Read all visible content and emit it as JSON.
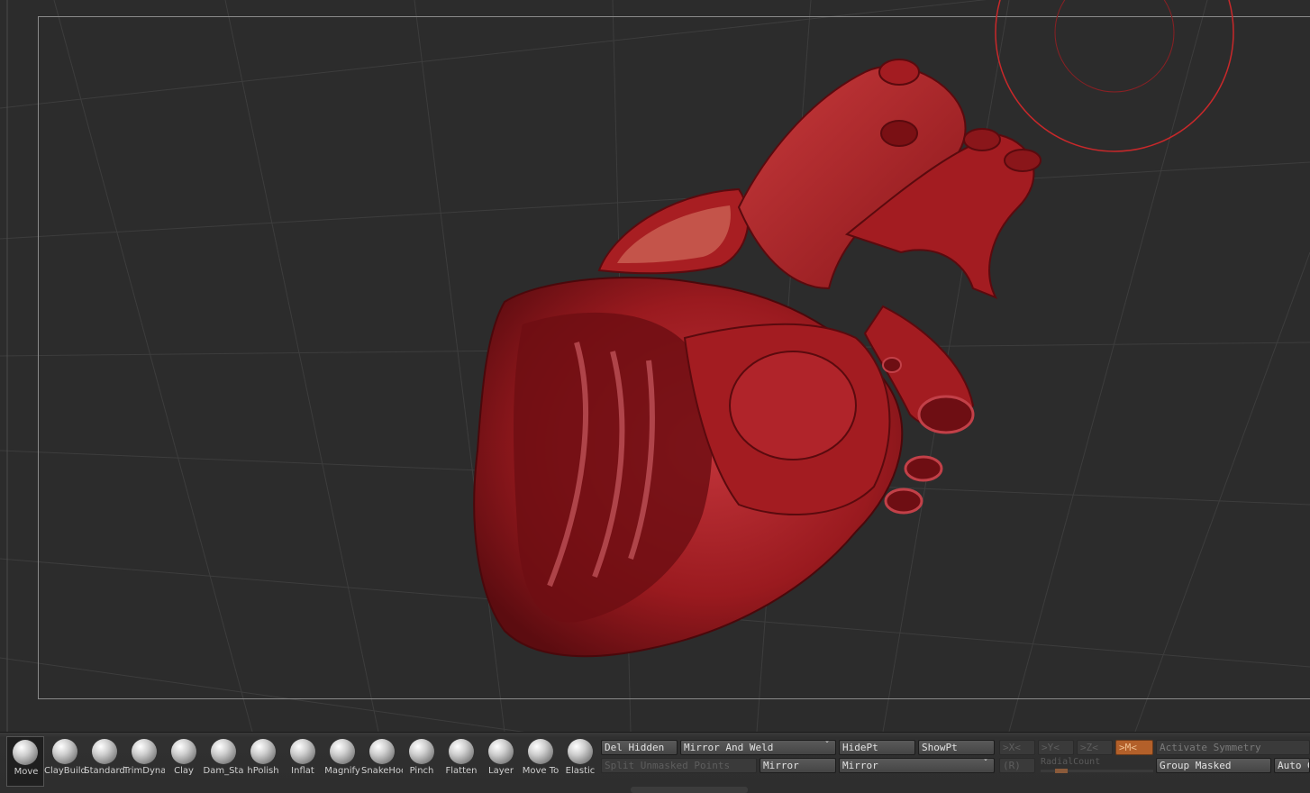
{
  "brushes": [
    {
      "label": "Move",
      "active": true
    },
    {
      "label": "ClayBuildup"
    },
    {
      "label": "Standard"
    },
    {
      "label": "TrimDyna"
    },
    {
      "label": "Clay"
    },
    {
      "label": "Dam_Sta"
    },
    {
      "label": "hPolish"
    },
    {
      "label": "Inflat"
    },
    {
      "label": "Magnify"
    },
    {
      "label": "SnakeHoo"
    },
    {
      "label": "Pinch"
    },
    {
      "label": "Flatten"
    },
    {
      "label": "Layer"
    },
    {
      "label": "Move To"
    },
    {
      "label": "Elastic"
    }
  ],
  "toolbar": {
    "del_hidden": "Del Hidden",
    "mirror_and_weld": "Mirror And Weld",
    "hide_pt": "HidePt",
    "show_pt": "ShowPt",
    "split_unmasked": "Split Unmasked Points",
    "mirror1": "Mirror",
    "mirror2": "Mirror",
    "sym_x": ">X<",
    "sym_y": ">Y<",
    "sym_z": ">Z<",
    "sym_m": ">M<",
    "activate_symmetry": "Activate Symmetry",
    "r_label": "(R)",
    "radial_count": "RadialCount",
    "group_masked": "Group Masked",
    "auto": "Auto G"
  },
  "colors": {
    "accent": "#c8282a",
    "model_base": "#9e1a1e",
    "active_sym": "#b3602a"
  }
}
